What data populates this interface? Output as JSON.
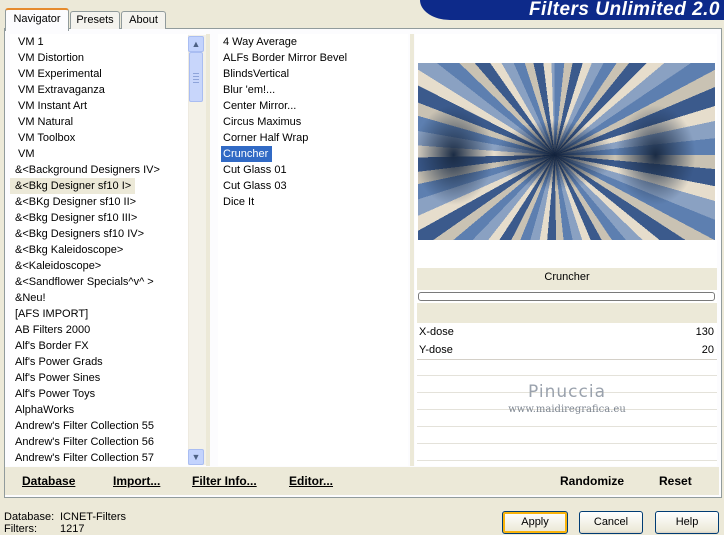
{
  "app": {
    "title": "Filters Unlimited 2.0"
  },
  "tabs": [
    "Navigator",
    "Presets",
    "About"
  ],
  "categories": [
    "VM 1",
    "VM Distortion",
    "VM Experimental",
    "VM Extravaganza",
    "VM Instant Art",
    "VM Natural",
    "VM Toolbox",
    "VM",
    "&<Background Designers IV>",
    "&<Bkg Designer sf10 I>",
    "&<BKg Designer sf10 II>",
    "&<Bkg Designer sf10 III>",
    "&<Bkg Designers sf10 IV>",
    "&<Bkg Kaleidoscope>",
    "&<Kaleidoscope>",
    "&<Sandflower Specials^v^ >",
    "&Neu!",
    "[AFS IMPORT]",
    "AB Filters 2000",
    "Alf's Border FX",
    "Alf's Power Grads",
    "Alf's Power Sines",
    "Alf's Power Toys",
    "AlphaWorks",
    "Andrew's Filter Collection 55",
    "Andrew's Filter Collection 56",
    "Andrew's Filter Collection 57"
  ],
  "selected_category_index": 9,
  "filters": [
    "4 Way Average",
    "ALFs Border Mirror Bevel",
    "BlindsVertical",
    "Blur 'em!...",
    "Center Mirror...",
    "Circus Maximus",
    "Corner Half Wrap",
    "Cruncher",
    "Cut Glass 01",
    "Cut Glass 03",
    "Dice It"
  ],
  "selected_filter_index": 7,
  "preview": {
    "filter_name": "Cruncher",
    "progress": 0,
    "params": [
      {
        "label": "X-dose",
        "value": "130"
      },
      {
        "label": "Y-dose",
        "value": "20"
      }
    ]
  },
  "watermark": {
    "line1": "Pinuccia",
    "line2": "www.maidiregrafica.eu"
  },
  "toolbar": {
    "database": "Database",
    "import": "Import...",
    "filter_info": "Filter Info...",
    "editor": "Editor...",
    "randomize": "Randomize",
    "reset": "Reset"
  },
  "status": {
    "database_label": "Database:",
    "database_value": "ICNET-Filters",
    "filters_label": "Filters:",
    "filters_value": "1217"
  },
  "buttons": {
    "apply": "Apply",
    "cancel": "Cancel",
    "help": "Help"
  },
  "colors": {
    "accent": "#316ac5",
    "banner": "#0d2a8a",
    "tab_highlight": "#e68b2c"
  }
}
